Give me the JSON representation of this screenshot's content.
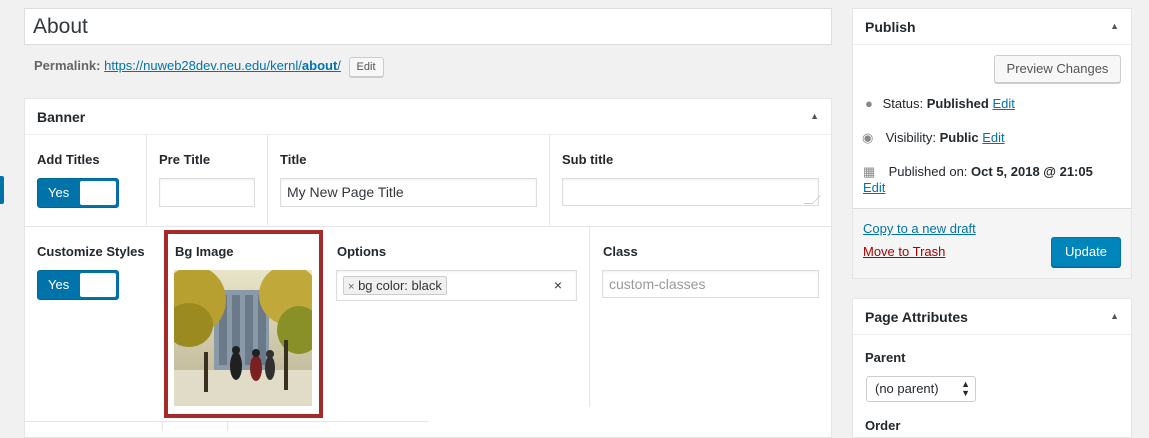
{
  "title_input": {
    "value": "About"
  },
  "permalink": {
    "label": "Permalink:",
    "url_base": "https://nuweb28dev.neu.edu/kernl/",
    "url_slug": "about",
    "url_trail": "/",
    "edit_label": "Edit"
  },
  "banner": {
    "heading": "Banner",
    "add_titles": {
      "label": "Add Titles",
      "toggle": "Yes"
    },
    "pre_title": {
      "label": "Pre Title",
      "value": ""
    },
    "title": {
      "label": "Title",
      "value": "My New Page Title"
    },
    "sub_title": {
      "label": "Sub title",
      "value": ""
    },
    "customize_styles": {
      "label": "Customize Styles",
      "toggle": "Yes"
    },
    "bg_image": {
      "label": "Bg Image"
    },
    "options": {
      "label": "Options",
      "tag_remove": "×",
      "tag": "bg color: black",
      "clear": "×"
    },
    "class": {
      "label": "Class",
      "placeholder": "custom-classes"
    }
  },
  "publish": {
    "heading": "Publish",
    "preview_button": "Preview Changes",
    "status_label": "Status:",
    "status_value": "Published",
    "visibility_label": "Visibility:",
    "visibility_value": "Public",
    "published_label": "Published on:",
    "published_value": "Oct 5, 2018 @ 21:05",
    "edit_label": "Edit",
    "copy_draft": "Copy to a new draft",
    "move_trash": "Move to Trash",
    "update_button": "Update"
  },
  "page_attributes": {
    "heading": "Page Attributes",
    "parent_label": "Parent",
    "parent_value": "(no parent)",
    "order_label": "Order"
  },
  "colors": {
    "accent": "#0085ba",
    "highlight_border": "#a52a2a",
    "trash": "#aa0000"
  }
}
